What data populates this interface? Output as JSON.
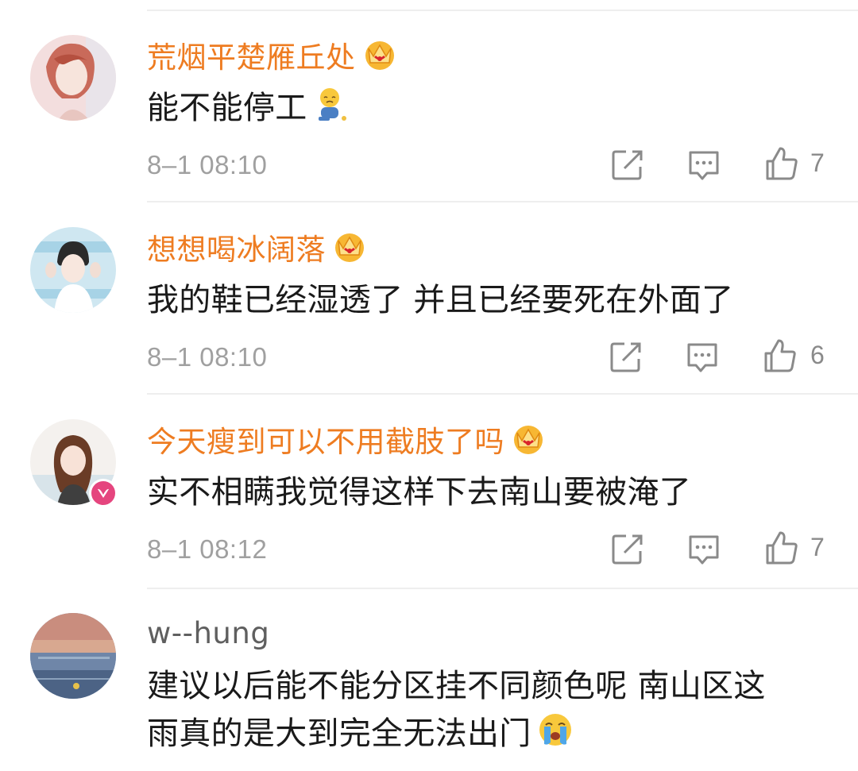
{
  "comments": [
    {
      "username": "荒烟平楚雁丘处",
      "vip": true,
      "text": "能不能停工",
      "emoji": "sad-sitting-emoji",
      "time": "8–1 08:10",
      "likes": "7"
    },
    {
      "username": "想想喝冰阔落",
      "vip": true,
      "text": "我的鞋已经湿透了 并且已经要死在外面了",
      "time": "8–1 08:10",
      "likes": "6"
    },
    {
      "username": "今天瘦到可以不用截肢了吗",
      "vip": true,
      "verified": true,
      "text": "实不相瞒我觉得这样下去南山要被淹了",
      "time": "8–1 08:12",
      "likes": "7"
    },
    {
      "username": "w--hung",
      "vip": false,
      "text_line1": "建议以后能不能分区挂不同颜色呢 南山区这",
      "text_line2": "雨真的是大到完全无法出门",
      "emoji": "crying-emoji"
    }
  ],
  "icons": {
    "repost": "repost-icon",
    "comment": "comment-icon",
    "like": "like-icon",
    "crown": "vip-crown-icon"
  },
  "colors": {
    "vip_name": "#ee7c21",
    "normal_name": "#5f5f5f",
    "meta": "#a0a0a0",
    "icon": "#8a8a8a"
  }
}
